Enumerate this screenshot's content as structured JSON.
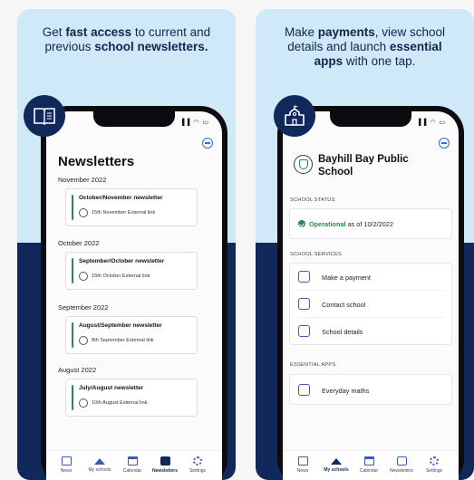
{
  "left_panel": {
    "headline_line1_pre": "Get ",
    "headline_line1_bold": "fast access",
    "headline_line1_post": " to current and",
    "headline_line2_pre": "previous ",
    "headline_line2_bold": "school newsletters.",
    "badge_icon": "book-icon",
    "screen": {
      "status_icons": "▐▐ ◠ ▭",
      "title": "Newsletters",
      "sections": [
        {
          "month": "November 2022",
          "card_title": "October/November newsletter",
          "card_sub": "15th November External link"
        },
        {
          "month": "October 2022",
          "card_title": "September/October newsletter",
          "card_sub": "15th October External link"
        },
        {
          "month": "September 2022",
          "card_title": "August/September newsletter",
          "card_sub": "8th September External link"
        },
        {
          "month": "August 2022",
          "card_title": "July/August newsletter",
          "card_sub": "10th August External link"
        }
      ]
    }
  },
  "right_panel": {
    "headline_line1_pre": "Make ",
    "headline_line1_bold": "payments",
    "headline_line1_post": ", view school",
    "headline_line2_pre": "details and launch ",
    "headline_line2_bold": "essential",
    "headline_line3_bold": "apps",
    "headline_line3_post": " with one tap.",
    "badge_icon": "school-building-icon",
    "screen": {
      "status_icons": "▐▐ ◠ ▭",
      "school_name": "Bayhill Bay Public School",
      "status_label": "SCHOOL STATUS",
      "status_word": "Operational",
      "status_suffix": " as of 10/2/2022",
      "services_label": "SCHOOL SERVICES",
      "services": [
        "Make a payment",
        "Contact school",
        "School details"
      ],
      "apps_label": "ESSENTIAL APPS",
      "apps": [
        "Everyday maths"
      ]
    }
  },
  "tabs": [
    "News",
    "My schools",
    "Calendar",
    "Newsletters",
    "Settings"
  ],
  "colors": {
    "navy": "#10285a",
    "light_blue": "#cfe9f8",
    "green": "#2a8a45",
    "accent_blue": "#3b5bbb"
  }
}
